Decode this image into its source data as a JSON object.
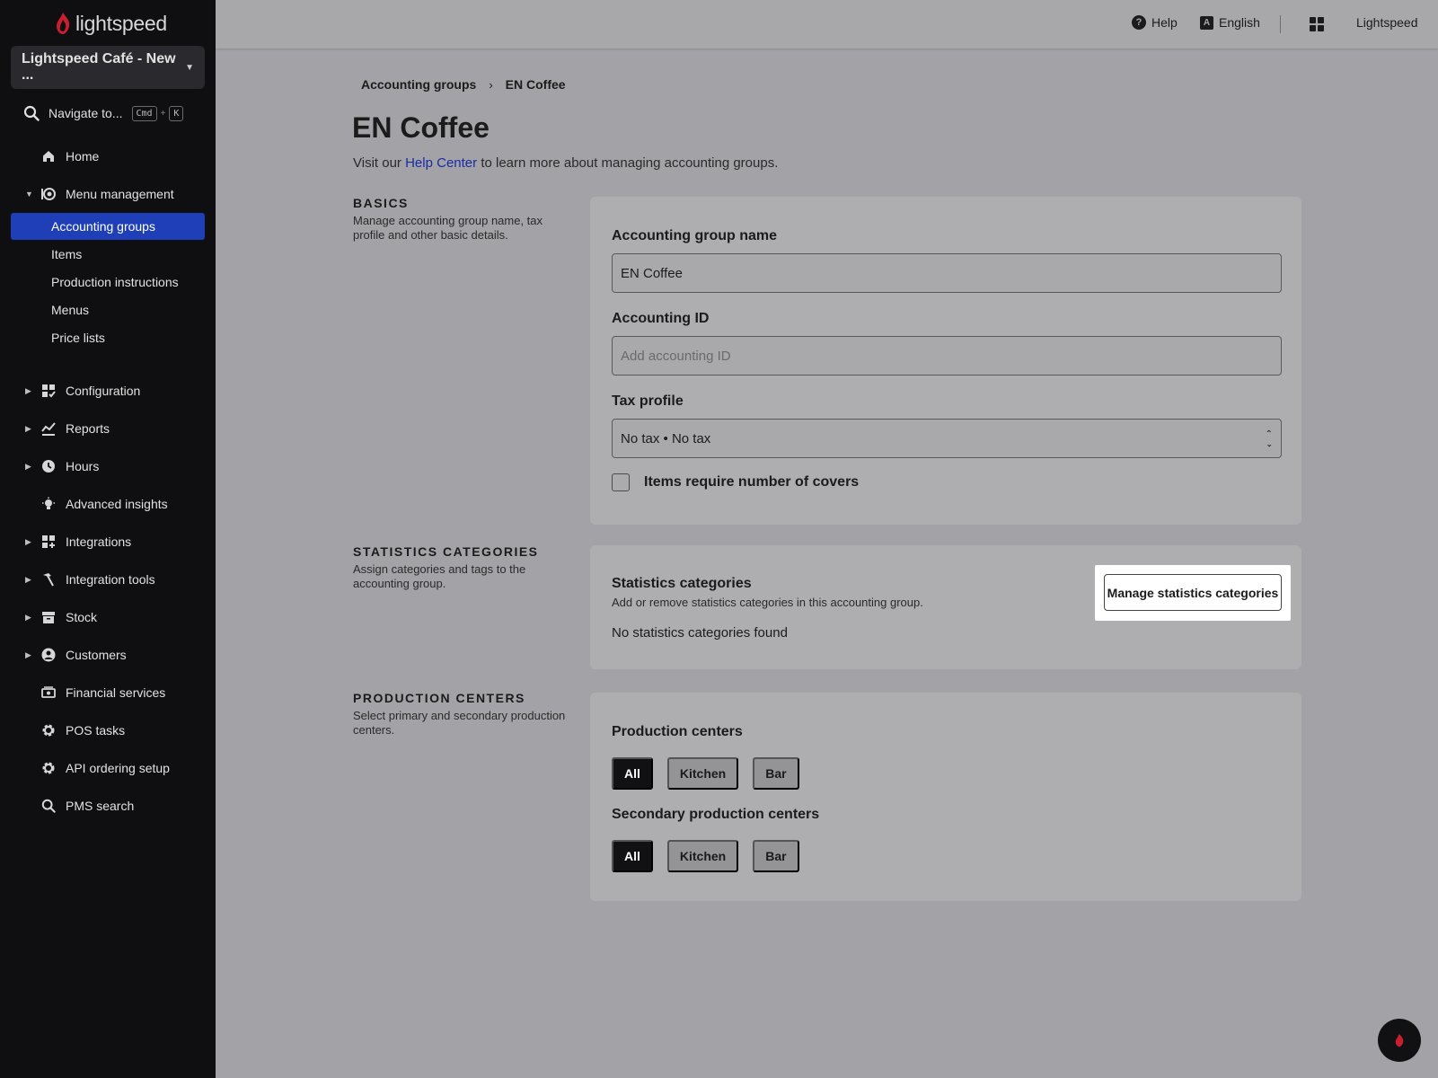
{
  "brand": {
    "logo_text": "lightspeed",
    "accent": "#1e3fb8",
    "flame_color": "#c81e2e"
  },
  "sidebar": {
    "store_name": "Lightspeed Café - New ...",
    "navigate": {
      "label": "Navigate to...",
      "key1": "Cmd",
      "plus": "+",
      "key2": "K"
    },
    "home": "Home",
    "menu_management": "Menu management",
    "sub_items": [
      "Accounting groups",
      "Items",
      "Production instructions",
      "Menus",
      "Price lists"
    ],
    "active_sub_item": "Accounting groups",
    "items": [
      {
        "label": "Configuration",
        "icon": "configuration-icon",
        "expandable": true
      },
      {
        "label": "Reports",
        "icon": "reports-icon",
        "expandable": true
      },
      {
        "label": "Hours",
        "icon": "clock-icon",
        "expandable": true
      },
      {
        "label": "Advanced insights",
        "icon": "lightbulb-icon",
        "expandable": false
      },
      {
        "label": "Integrations",
        "icon": "integrations-icon",
        "expandable": true
      },
      {
        "label": "Integration tools",
        "icon": "hammer-icon",
        "expandable": true
      },
      {
        "label": "Stock",
        "icon": "stock-icon",
        "expandable": true
      },
      {
        "label": "Customers",
        "icon": "customer-icon",
        "expandable": true
      },
      {
        "label": "Financial services",
        "icon": "cash-icon",
        "expandable": false
      },
      {
        "label": "POS tasks",
        "icon": "gear-icon",
        "expandable": false
      },
      {
        "label": "API ordering setup",
        "icon": "gear-icon",
        "expandable": false
      },
      {
        "label": "PMS search",
        "icon": "search-icon",
        "expandable": false
      }
    ]
  },
  "topbar": {
    "help": "Help",
    "language": "English",
    "language_glyph": "A",
    "help_glyph": "?",
    "account": "Lightspeed"
  },
  "breadcrumb": {
    "parent": "Accounting groups",
    "separator": "›",
    "current": "EN Coffee"
  },
  "page": {
    "title": "EN Coffee",
    "intro_prefix": "Visit our",
    "intro_link": "Help Center",
    "intro_suffix": "to learn more about managing accounting groups."
  },
  "basics": {
    "heading": "BASICS",
    "description": "Manage accounting group name, tax profile and other basic details.",
    "name_label": "Accounting group name",
    "name_value": "EN Coffee",
    "id_label": "Accounting ID",
    "id_placeholder": "Add accounting ID",
    "tax_label": "Tax profile",
    "tax_value": "No tax • No tax",
    "covers_label": "Items require number of covers",
    "covers_checked": false
  },
  "statistics": {
    "heading": "STATISTICS CATEGORIES",
    "description": "Assign categories and tags to the accounting group.",
    "title": "Statistics categories",
    "subtitle": "Add or remove statistics categories in this accounting group.",
    "empty": "No statistics categories found",
    "manage_button": "Manage statistics categories"
  },
  "production": {
    "heading": "PRODUCTION CENTERS",
    "description": "Select primary and secondary production centers.",
    "primary_label": "Production centers",
    "primary_options": [
      "All",
      "Kitchen",
      "Bar"
    ],
    "primary_selected": "All",
    "secondary_label": "Secondary production centers",
    "secondary_options": [
      "All",
      "Kitchen",
      "Bar"
    ],
    "secondary_selected": "All"
  }
}
